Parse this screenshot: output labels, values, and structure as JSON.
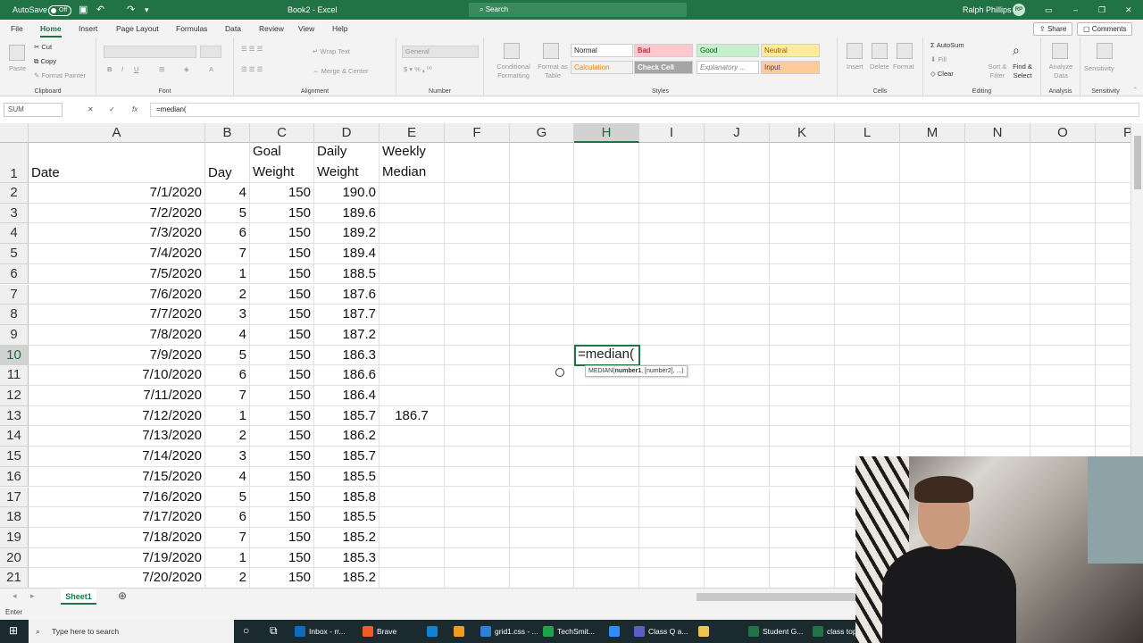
{
  "titlebar": {
    "autosave_label": "AutoSave",
    "autosave_state": "Off",
    "doc_title": "Book2 - Excel",
    "search_placeholder": "Search",
    "user_name": "Ralph Phillips",
    "user_initials": "RP"
  },
  "menu": {
    "items": [
      "File",
      "Home",
      "Insert",
      "Page Layout",
      "Formulas",
      "Data",
      "Review",
      "View",
      "Help"
    ],
    "active": "Home",
    "share_label": "Share",
    "comments_label": "Comments"
  },
  "ribbon": {
    "clipboard": {
      "paste": "Paste",
      "cut": "Cut",
      "copy": "Copy",
      "format_painter": "Format Painter",
      "label": "Clipboard"
    },
    "font": {
      "label": "Font",
      "bold": "B",
      "italic": "I",
      "underline": "U"
    },
    "alignment": {
      "wrap_text": "Wrap Text",
      "merge_center": "Merge & Center",
      "label": "Alignment"
    },
    "number": {
      "format": "General",
      "label": "Number"
    },
    "styles": {
      "conditional_formatting": "Conditional Formatting",
      "format_as_table": "Format as Table",
      "normal": "Normal",
      "bad": "Bad",
      "good": "Good",
      "neutral": "Neutral",
      "calculation": "Calculation",
      "check_cell": "Check Cell",
      "explanatory": "Explanatory ...",
      "input": "Input",
      "label": "Styles"
    },
    "cells": {
      "insert": "Insert",
      "delete": "Delete",
      "format": "Format",
      "label": "Cells"
    },
    "editing": {
      "autosum": "AutoSum",
      "fill": "Fill",
      "clear": "Clear",
      "sort_filter": "Sort & Filter",
      "find_select": "Find & Select",
      "label": "Editing"
    },
    "analysis": {
      "analyze_data": "Analyze Data",
      "label": "Analysis"
    },
    "sensitivity": {
      "sensitivity": "Sensitivity",
      "label": "Sensitivity"
    }
  },
  "formula_bar": {
    "name_box": "SUM",
    "cancel": "✕",
    "enter": "✓",
    "fx": "fx",
    "formula": "=median("
  },
  "grid": {
    "columns": [
      "A",
      "B",
      "C",
      "D",
      "E",
      "F",
      "G",
      "H",
      "I",
      "J",
      "K",
      "L",
      "M",
      "N",
      "O",
      "P"
    ],
    "selected_column": "H",
    "selected_row": "10",
    "header_row": {
      "A": "Date",
      "B": "Day",
      "C_line1": "Goal",
      "C_line2": "Weight",
      "D_line1": "Daily",
      "D_line2": "Weight",
      "E_line1": "Weekly",
      "E_line2": "Median"
    },
    "rows": [
      {
        "num": "2",
        "date": "7/1/2020",
        "day": "4",
        "goal": "150",
        "daily": "190.0",
        "median": ""
      },
      {
        "num": "3",
        "date": "7/2/2020",
        "day": "5",
        "goal": "150",
        "daily": "189.6",
        "median": ""
      },
      {
        "num": "4",
        "date": "7/3/2020",
        "day": "6",
        "goal": "150",
        "daily": "189.2",
        "median": ""
      },
      {
        "num": "5",
        "date": "7/4/2020",
        "day": "7",
        "goal": "150",
        "daily": "189.4",
        "median": ""
      },
      {
        "num": "6",
        "date": "7/5/2020",
        "day": "1",
        "goal": "150",
        "daily": "188.5",
        "median": ""
      },
      {
        "num": "7",
        "date": "7/6/2020",
        "day": "2",
        "goal": "150",
        "daily": "187.6",
        "median": ""
      },
      {
        "num": "8",
        "date": "7/7/2020",
        "day": "3",
        "goal": "150",
        "daily": "187.7",
        "median": ""
      },
      {
        "num": "9",
        "date": "7/8/2020",
        "day": "4",
        "goal": "150",
        "daily": "187.2",
        "median": ""
      },
      {
        "num": "10",
        "date": "7/9/2020",
        "day": "5",
        "goal": "150",
        "daily": "186.3",
        "median": ""
      },
      {
        "num": "11",
        "date": "7/10/2020",
        "day": "6",
        "goal": "150",
        "daily": "186.6",
        "median": ""
      },
      {
        "num": "12",
        "date": "7/11/2020",
        "day": "7",
        "goal": "150",
        "daily": "186.4",
        "median": ""
      },
      {
        "num": "13",
        "date": "7/12/2020",
        "day": "1",
        "goal": "150",
        "daily": "185.7",
        "median": "186.7"
      },
      {
        "num": "14",
        "date": "7/13/2020",
        "day": "2",
        "goal": "150",
        "daily": "186.2",
        "median": ""
      },
      {
        "num": "15",
        "date": "7/14/2020",
        "day": "3",
        "goal": "150",
        "daily": "185.7",
        "median": ""
      },
      {
        "num": "16",
        "date": "7/15/2020",
        "day": "4",
        "goal": "150",
        "daily": "185.5",
        "median": ""
      },
      {
        "num": "17",
        "date": "7/16/2020",
        "day": "5",
        "goal": "150",
        "daily": "185.8",
        "median": ""
      },
      {
        "num": "18",
        "date": "7/17/2020",
        "day": "6",
        "goal": "150",
        "daily": "185.5",
        "median": ""
      },
      {
        "num": "19",
        "date": "7/18/2020",
        "day": "7",
        "goal": "150",
        "daily": "185.2",
        "median": ""
      },
      {
        "num": "20",
        "date": "7/19/2020",
        "day": "1",
        "goal": "150",
        "daily": "185.3",
        "median": ""
      },
      {
        "num": "21",
        "date": "7/20/2020",
        "day": "2",
        "goal": "150",
        "daily": "185.2",
        "median": ""
      }
    ],
    "active_cell_text": "=median(",
    "tooltip": {
      "fn": "MEDIAN(",
      "arg1": "number1",
      "rest": ", [number2], ...)"
    }
  },
  "sheets": {
    "active": "Sheet1"
  },
  "status": {
    "mode": "Enter"
  },
  "taskbar": {
    "search_placeholder": "Type here to search",
    "apps": [
      {
        "label": "Inbox - rr...",
        "color": "#0f6cbd"
      },
      {
        "label": "Brave",
        "color": "#f05a24"
      },
      {
        "label": "",
        "color": "#0a84d6"
      },
      {
        "label": "",
        "color": "#f29c1f"
      },
      {
        "label": "grid1.css - ...",
        "color": "#2f7fd8"
      },
      {
        "label": "TechSmit...",
        "color": "#1fa34a"
      },
      {
        "label": "",
        "color": "#2d8cff"
      },
      {
        "label": "Class Q a...",
        "color": "#5b5fc7"
      },
      {
        "label": "",
        "color": "#f2c14e"
      },
      {
        "label": "Student G...",
        "color": "#217346"
      },
      {
        "label": "class top...",
        "color": "#217346"
      }
    ]
  },
  "colors": {
    "accent": "#217346",
    "grid_line": "#e1e1e1",
    "header_bg": "#efefef"
  }
}
